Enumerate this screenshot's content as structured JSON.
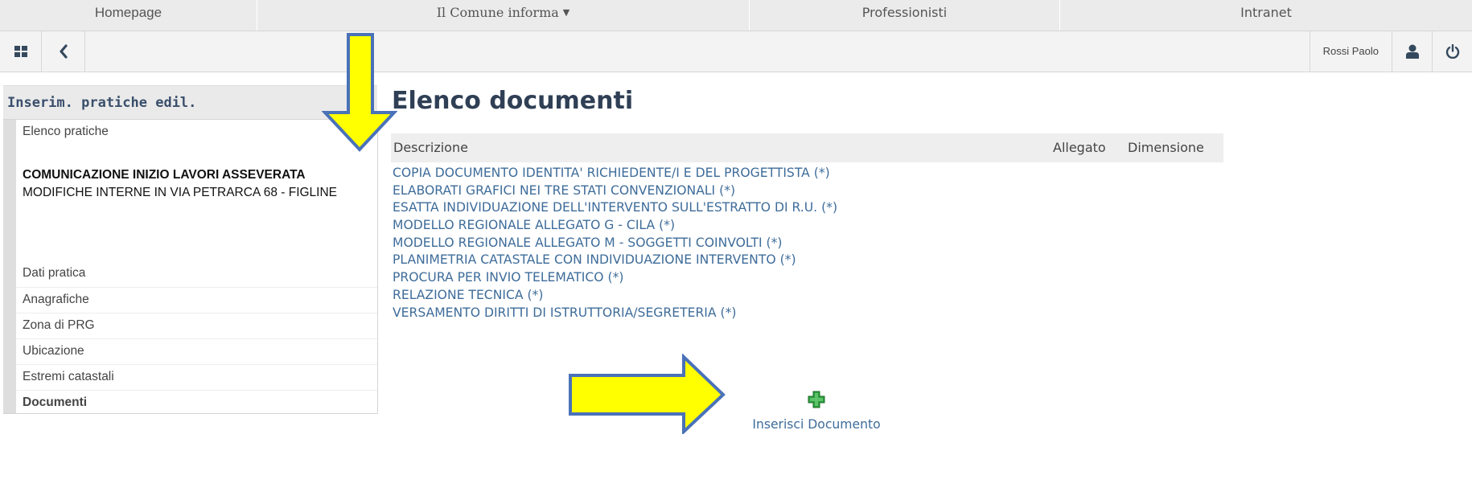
{
  "topnav": {
    "items": [
      {
        "label": "Homepage"
      },
      {
        "label": "Il Comune informa"
      },
      {
        "label": "Professionisti"
      },
      {
        "label": "Intranet"
      }
    ]
  },
  "toolbar": {
    "user_name": "Rossi Paolo"
  },
  "sidebar": {
    "title": "Inserim. pratiche edil.",
    "list_link": "Elenco pratiche",
    "pratica_title": "COMUNICAZIONE INIZIO LAVORI ASSEVERATA",
    "pratica_desc": "MODIFICHE INTERNE IN VIA PETRARCA 68 - FIGLINE",
    "items": [
      {
        "label": "Dati pratica"
      },
      {
        "label": "Anagrafiche"
      },
      {
        "label": "Zona di PRG"
      },
      {
        "label": "Ubicazione"
      },
      {
        "label": "Estremi catastali"
      },
      {
        "label": "Documenti"
      }
    ]
  },
  "main": {
    "title": "Elenco documenti",
    "columns": [
      "Descrizione",
      "Allegato",
      "Dimensione"
    ],
    "documents": [
      "COPIA DOCUMENTO IDENTITA' RICHIEDENTE/I E DEL PROGETTISTA (*)",
      "ELABORATI GRAFICI NEI TRE STATI CONVENZIONALI (*)",
      "ESATTA INDIVIDUAZIONE DELL'INTERVENTO SULL'ESTRATTO DI R.U. (*)",
      "MODELLO REGIONALE ALLEGATO G - CILA (*)",
      "MODELLO REGIONALE ALLEGATO M - SOGGETTI COINVOLTI (*)",
      "PLANIMETRIA CATASTALE CON INDIVIDUAZIONE INTERVENTO (*)",
      "PROCURA PER INVIO TELEMATICO (*)",
      "RELAZIONE TECNICA (*)",
      "VERSAMENTO DIRITTI DI ISTRUTTORIA/SEGRETERIA (*)"
    ],
    "insert_label": "Inserisci Documento"
  },
  "icons": {
    "grid": "grid-icon",
    "back": "chevron-left-icon",
    "user": "user-icon",
    "power": "power-icon",
    "add": "plus-icon",
    "annotation": "arrow-icon"
  },
  "colors": {
    "link": "#3e6c9a",
    "title": "#2f3f55",
    "sidebar_title": "#3a4f6b",
    "arrow_fill": "#ffff00",
    "arrow_stroke": "#4a72b8",
    "plus_green": "#2e9d3c"
  }
}
